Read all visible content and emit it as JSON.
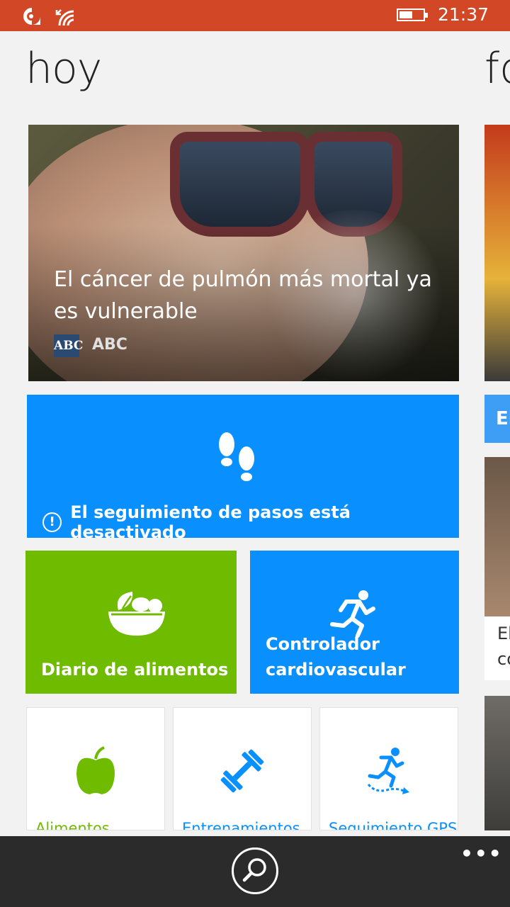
{
  "status_bar": {
    "time": "21:37",
    "battery_level": 0.55,
    "icons": [
      "notification-icon",
      "wifi-icon",
      "battery-icon"
    ]
  },
  "page": {
    "title": "hoy",
    "next_title_partial": "fo"
  },
  "news": {
    "headline": "El cáncer de pulmón más mortal ya es vulnerable",
    "source_logo_text": "ABC",
    "source_name": "ABC"
  },
  "steps_tile": {
    "message": "El seguimiento de pasos está desactivado",
    "icon": "footprints-icon"
  },
  "tiles": {
    "food_diary": {
      "label": "Diario de alimentos",
      "icon": "salad-bowl-icon",
      "color": "#6fbb00"
    },
    "cardio": {
      "label_line1": "Controlador",
      "label_line2": "cardiovascular",
      "icon": "runner-icon",
      "color": "#0a8fff"
    }
  },
  "small_tiles": [
    {
      "label": "Alimentos",
      "icon": "apple-icon",
      "color": "#6fbb00"
    },
    {
      "label": "Entrenamientos",
      "icon": "dumbbell-icon",
      "color": "#0a8fff"
    },
    {
      "label": "Seguimiento GPS",
      "icon": "gps-runner-icon",
      "color": "#0a8fff"
    }
  ],
  "next_panel": {
    "tile_partial": "El",
    "card_line1": "El",
    "card_line2": "co"
  },
  "app_bar": {
    "more": "•••"
  }
}
